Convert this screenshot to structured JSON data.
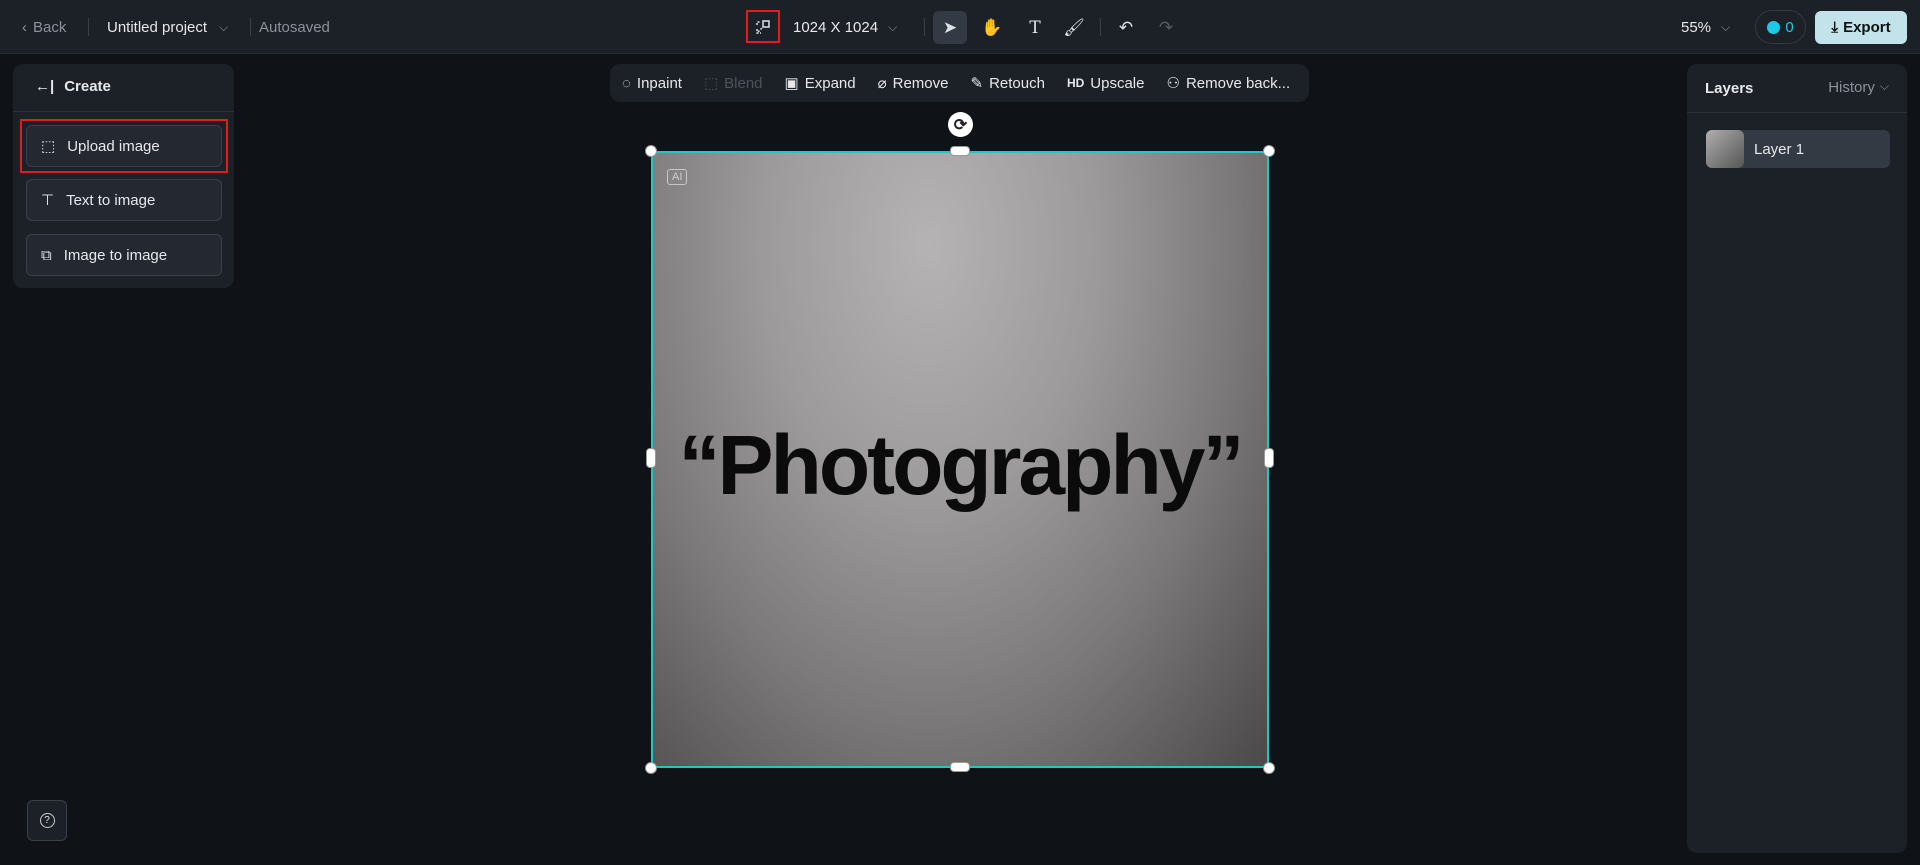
{
  "topbar": {
    "back": "Back",
    "project": "Untitled project",
    "status": "Autosaved",
    "size": "1024 X 1024",
    "zoom": "55%",
    "credits": "0",
    "export": "Export"
  },
  "toolbar": {
    "inpaint": "Inpaint",
    "blend": "Blend",
    "expand": "Expand",
    "remove": "Remove",
    "retouch": "Retouch",
    "upscale_badge": "HD",
    "upscale": "Upscale",
    "remove_bg": "Remove back..."
  },
  "left_panel": {
    "title": "Create",
    "items": [
      {
        "label": "Upload image"
      },
      {
        "label": "Text to image"
      },
      {
        "label": "Image to image"
      }
    ]
  },
  "canvas": {
    "ai_badge": "AI",
    "image_text": "“Photography”"
  },
  "right_panel": {
    "tab_layers": "Layers",
    "tab_history": "History",
    "layers": [
      {
        "name": "Layer 1"
      }
    ]
  },
  "colors": {
    "accent": "#1ec8c8",
    "highlight": "#e01e1e",
    "export_bg": "#c3e3ea"
  }
}
